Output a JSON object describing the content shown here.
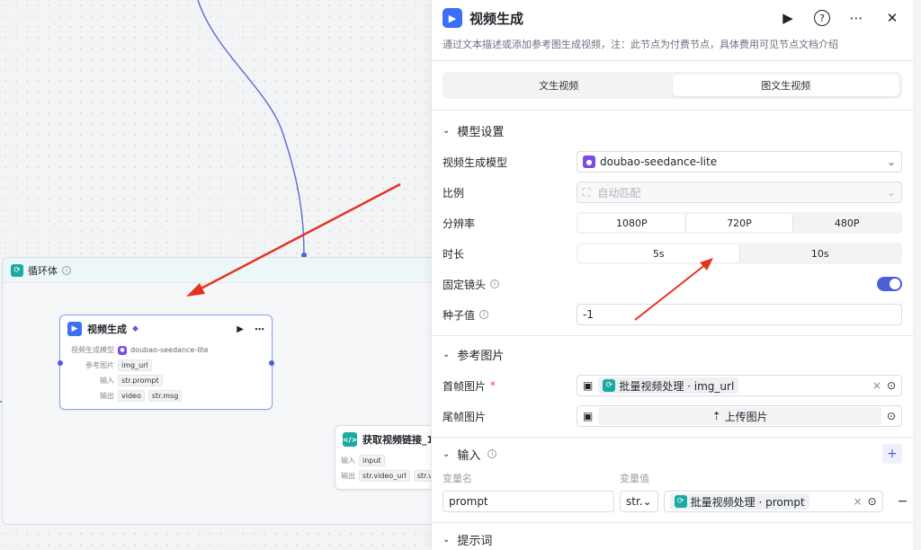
{
  "canvas": {
    "loop": {
      "title": "循环体"
    },
    "video_node": {
      "title": "视频生成",
      "rows": [
        {
          "label": "视频生成模型",
          "values": [
            "doubao-seedance-lite"
          ]
        },
        {
          "label": "参考图片",
          "values": [
            "img_url"
          ]
        },
        {
          "label": "输入",
          "values": [
            "str.prompt"
          ]
        },
        {
          "label": "输出",
          "values": [
            "video",
            "str.msg"
          ]
        }
      ]
    },
    "link_node": {
      "title": "获取视频链接_1",
      "rows": [
        {
          "label": "输入",
          "values": [
            "input"
          ]
        },
        {
          "label": "输出",
          "values": [
            "str.video_url",
            "str.vi"
          ]
        }
      ]
    }
  },
  "panel": {
    "title": "视频生成",
    "description": "通过文本描述或添加参考图生成视频，注：此节点为付费节点，具体费用可见节点文档介绍",
    "tabs": [
      "文生视频",
      "图文生视频"
    ],
    "model_section": {
      "title": "模型设置",
      "model_label": "视频生成模型",
      "model_value": "doubao-seedance-lite",
      "ratio_label": "比例",
      "ratio_value": "自动匹配",
      "resolution_label": "分辨率",
      "resolution_options": [
        "1080P",
        "720P",
        "480P"
      ],
      "duration_label": "时长",
      "duration_options": [
        "5s",
        "10s"
      ],
      "fixed_camera_label": "固定镜头",
      "seed_label": "种子值",
      "seed_value": "-1"
    },
    "ref_section": {
      "title": "参考图片",
      "first_label": "首帧图片",
      "first_value": "批量视频处理 · img_url",
      "last_label": "尾帧图片",
      "upload_label": "上传图片"
    },
    "input_section": {
      "title": "输入",
      "col_name": "变量名",
      "col_value": "变量值",
      "var_name": "prompt",
      "var_type": "str.",
      "var_value": "批量视频处理 · prompt"
    },
    "next_section": "提示词"
  }
}
